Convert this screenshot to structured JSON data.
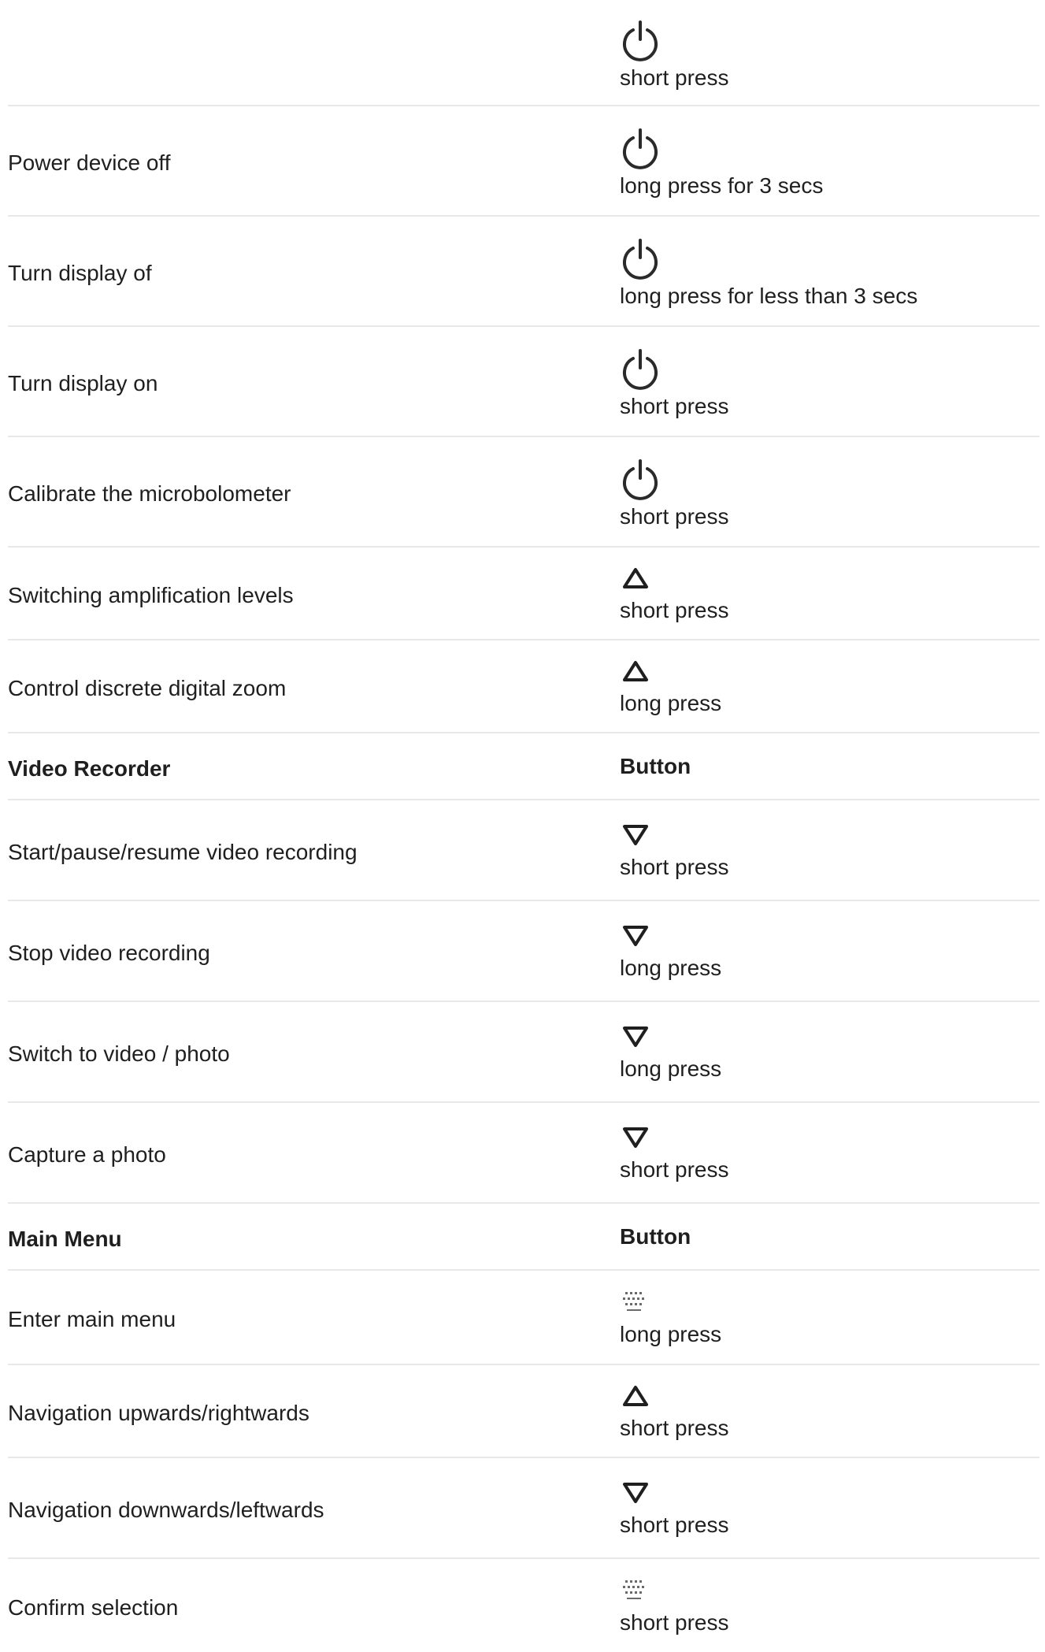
{
  "rows": [
    {
      "type": "action",
      "label": "",
      "icon": "power-icon",
      "press": "short press"
    },
    {
      "type": "action",
      "label": "Power device off",
      "icon": "power-icon",
      "press": "long press for 3 secs"
    },
    {
      "type": "action",
      "label": "Turn display of",
      "icon": "power-icon",
      "press": "long press for less than 3 secs"
    },
    {
      "type": "action",
      "label": "Turn display on",
      "icon": "power-icon",
      "press": "short press"
    },
    {
      "type": "action",
      "label": "Calibrate the microbolometer",
      "icon": "power-icon",
      "press": "short press"
    },
    {
      "type": "action",
      "label": "Switching amplification levels",
      "icon": "up-triangle-icon",
      "press": "short press"
    },
    {
      "type": "action",
      "label": "Control discrete digital zoom",
      "icon": "up-triangle-icon",
      "press": "long press"
    },
    {
      "type": "header",
      "label": "Video Recorder",
      "right": "Button"
    },
    {
      "type": "action",
      "label": "Start/pause/resume video recording",
      "icon": "down-triangle-icon",
      "press": "short press"
    },
    {
      "type": "action",
      "label": "Stop video recording",
      "icon": "down-triangle-icon",
      "press": "long press"
    },
    {
      "type": "action",
      "label": "Switch to video / photo",
      "icon": "down-triangle-icon",
      "press": "long press"
    },
    {
      "type": "action",
      "label": "Capture a photo",
      "icon": "down-triangle-icon",
      "press": "short press"
    },
    {
      "type": "header",
      "label": "Main Menu",
      "right": "Button"
    },
    {
      "type": "action",
      "label": "Enter main menu",
      "icon": "menu-icon",
      "press": "long press"
    },
    {
      "type": "action",
      "label": "Navigation upwards/rightwards",
      "icon": "up-triangle-icon",
      "press": "short press"
    },
    {
      "type": "action",
      "label": "Navigation downwards/leftwards",
      "icon": "down-triangle-icon",
      "press": "short press"
    },
    {
      "type": "action",
      "label": "Confirm selection",
      "icon": "menu-icon",
      "press": "short press"
    }
  ]
}
